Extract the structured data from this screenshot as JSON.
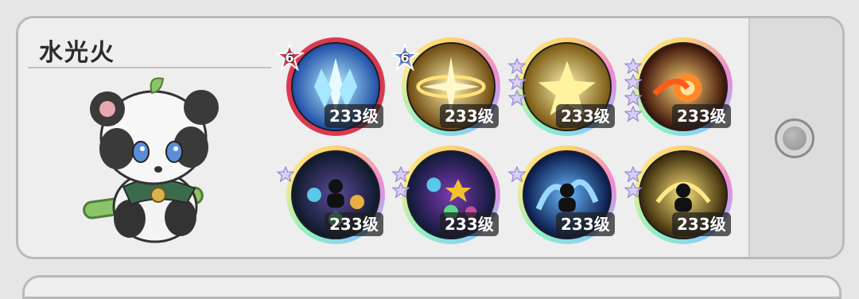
{
  "panel": {
    "title": "水光火",
    "side_button": "round-toggle"
  },
  "pet": {
    "name": "",
    "icon": "panda-pet"
  },
  "skills": [
    {
      "level": "233级",
      "badge": "6",
      "badge_color": "#d93a52",
      "stars": 0,
      "ring": "red",
      "art": "ice-crystal"
    },
    {
      "level": "233级",
      "badge": "6",
      "badge_color": "#6b8fe0",
      "stars": 0,
      "ring": "rainbow",
      "art": "golden-halo"
    },
    {
      "level": "233级",
      "badge": "",
      "stars": 3,
      "ring": "rainbow",
      "art": "gold-star-burst"
    },
    {
      "level": "233级",
      "badge": "",
      "stars": 4,
      "ring": "rainbow",
      "art": "fire-orb"
    },
    {
      "level": "233级",
      "badge": "",
      "stars": 1,
      "ring": "rainbow",
      "art": "locked-prism"
    },
    {
      "level": "233级",
      "badge": "",
      "stars": 2,
      "ring": "rainbow",
      "art": "locked-nebula"
    },
    {
      "level": "233级",
      "badge": "",
      "stars": 1,
      "ring": "rainbow",
      "art": "locked-water"
    },
    {
      "level": "233级",
      "badge": "",
      "stars": 2,
      "ring": "rainbow",
      "art": "locked-gold"
    }
  ],
  "colors": {
    "card_bg": "#eeeeee",
    "border": "#b9b9b9",
    "level_bg": "#1e1e1e"
  }
}
